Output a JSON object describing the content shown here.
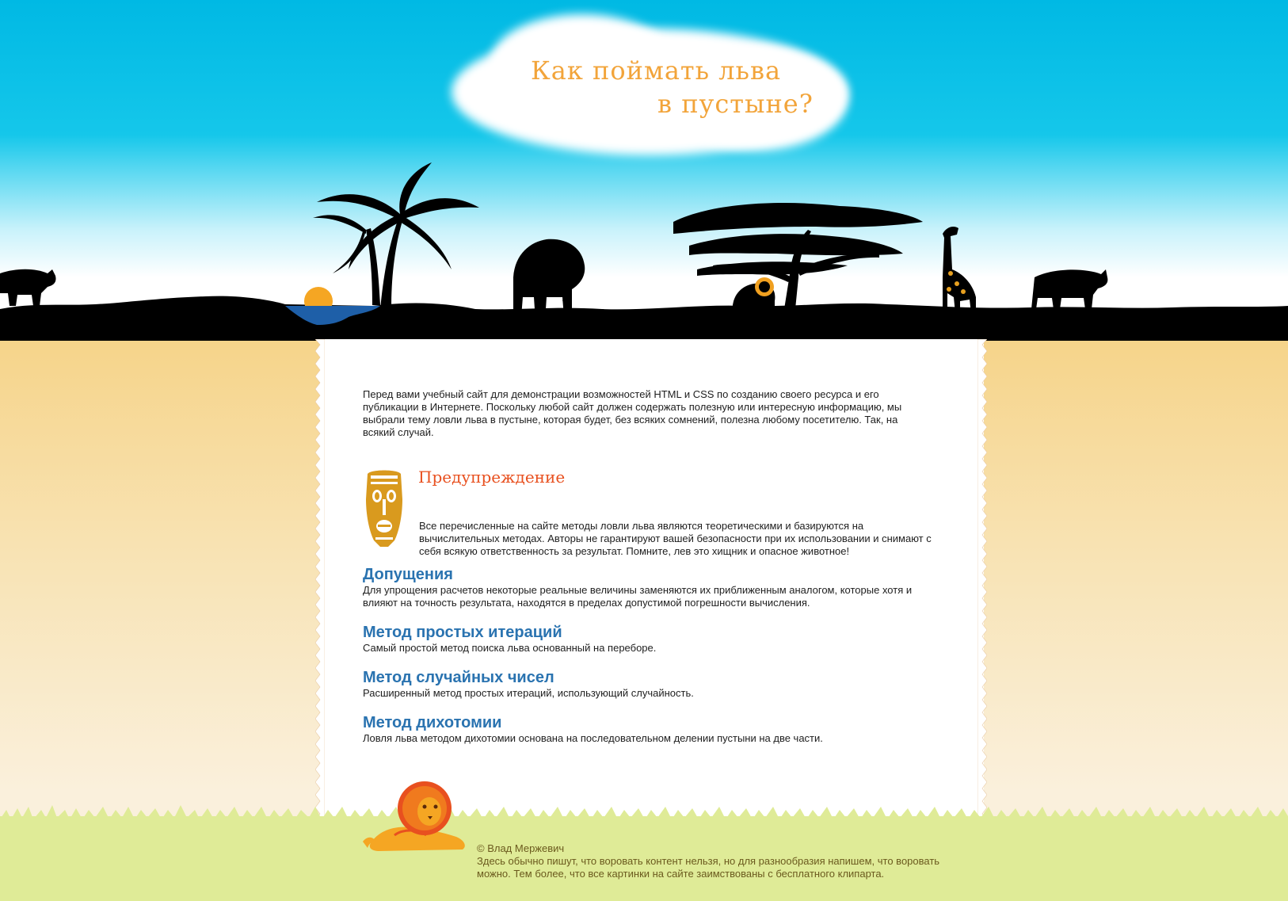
{
  "header": {
    "title_line1": "Как поймать льва",
    "title_line2": "в пустыне?"
  },
  "intro": "Перед вами учебный сайт для демонстрации возможностей HTML и CSS по созданию своего ресурса и его публикации в Интернете. Поскольку любой сайт должен содержать полезную или интересную информацию, мы выбрали тему ловли льва в пустыне, которая будет, без всяких сомнений, полезна любому посетителю. Так, на всякий случай.",
  "warning": {
    "title": "Предупреждение",
    "text": "Все перечисленные на сайте методы ловли льва являются теоретическими и базируются на вычислительных методах. Авторы не гарантируют вашей безопасности при их использовании и снимают с себя всякую ответственность за результат. Помните, лев это хищник и опасное животное!"
  },
  "sections": [
    {
      "title": "Допущения",
      "text": "Для упрощения расчетов некоторые реальные величины заменяются их приближенным аналогом, которые хотя и влияют на точность результата, находятся в пределах допустимой погрешности вычисления."
    },
    {
      "title": "Метод простых итераций",
      "text": "Самый простой метод поиска льва основанный на переборе."
    },
    {
      "title": "Метод случайных чисел",
      "text": "Расширенный метод простых итераций, использующий случайность."
    },
    {
      "title": "Метод дихотомии",
      "text": "Ловля льва методом дихотомии основана на последовательном делении пустыни на две части."
    }
  ],
  "footer": {
    "copyright": "© Влад Мержевич",
    "note": "Здесь обычно пишут, что воровать контент нельзя, но для разнообразия напишем, что воровать можно. Тем более, что все картинки на сайте заимствованы с бесплатного клипарта."
  },
  "icons": [
    "african-mask-icon",
    "lion-icon",
    "elephant-icon",
    "giraffe-icon",
    "rhino-icon",
    "palm-tree-icon",
    "acacia-tree-icon",
    "sun-icon"
  ],
  "colors": {
    "sky": "#00b9e4",
    "sand": "#f6d48a",
    "title": "#f2a43a",
    "warning": "#e8501f",
    "heading": "#2a73b0",
    "grass": "#dfeb97",
    "footer_text": "#6b5a1e"
  }
}
